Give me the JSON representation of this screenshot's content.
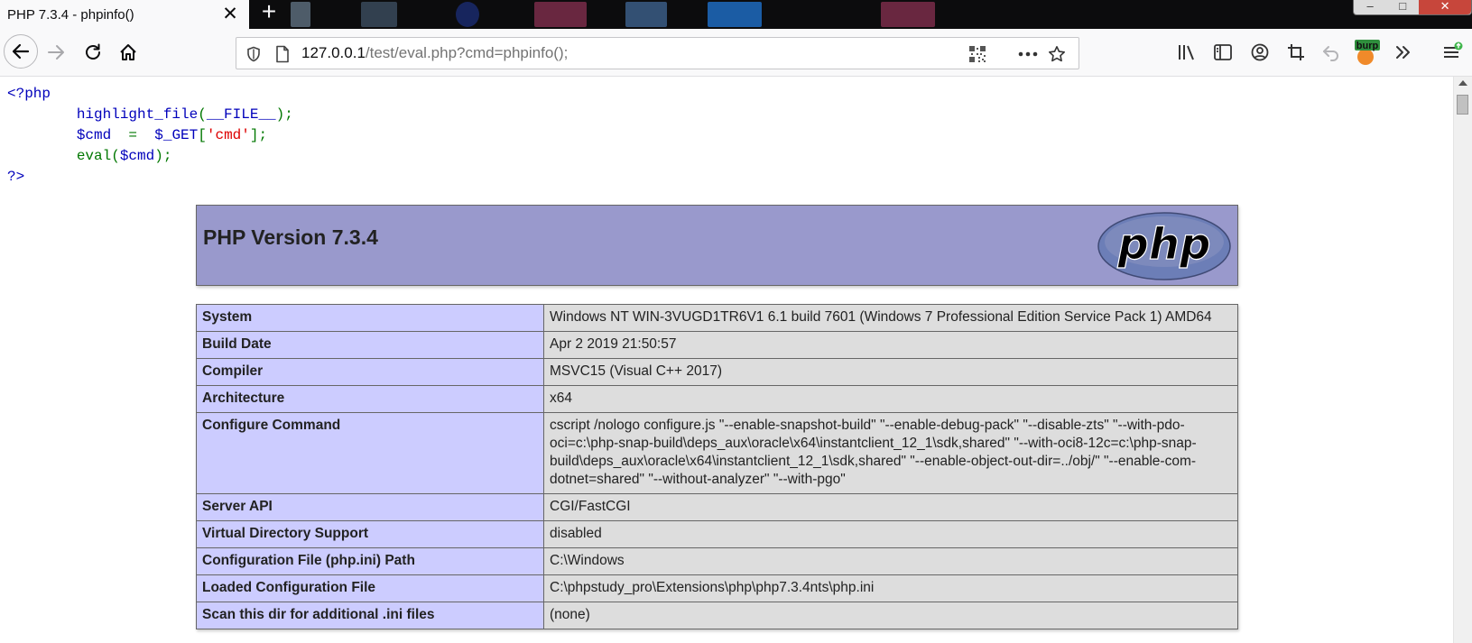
{
  "window": {
    "tab_title": "PHP 7.3.4 - phpinfo()",
    "tab_close_glyph": "✕",
    "new_tab_glyph": "+"
  },
  "navbar": {
    "url_host": "127.0.0.1",
    "url_path": "/test/eval.php?cmd=phpinfo();",
    "icons": [
      "back-arrow-icon",
      "forward-arrow-icon",
      "reload-icon",
      "home-icon",
      "shield-icon",
      "page-icon",
      "qr-code-icon",
      "more-icon",
      "star-icon",
      "library-icon",
      "sidebar-icon",
      "account-icon",
      "crop-icon",
      "undo-icon",
      "burp-extension-icon",
      "overflow-icon",
      "menu-icon"
    ],
    "burp_label": "burp"
  },
  "source_code": {
    "line1": "<?php",
    "line2_fn": "highlight_file",
    "line2_arg": "__FILE__",
    "line3_var": "$cmd",
    "line3_op": "=",
    "line3_get": "$_GET",
    "line3_key": "'cmd'",
    "line4_fn": "eval",
    "line4_arg": "$cmd",
    "line5": "?>"
  },
  "phpinfo": {
    "title": "PHP Version 7.3.4",
    "logo_text": "php",
    "rows": [
      {
        "label": "System",
        "value": "Windows NT WIN-3VUGD1TR6V1 6.1 build 7601 (Windows 7 Professional Edition Service Pack 1) AMD64"
      },
      {
        "label": "Build Date",
        "value": "Apr 2 2019 21:50:57"
      },
      {
        "label": "Compiler",
        "value": "MSVC15 (Visual C++ 2017)"
      },
      {
        "label": "Architecture",
        "value": "x64"
      },
      {
        "label": "Configure Command",
        "value": "cscript /nologo configure.js \"--enable-snapshot-build\" \"--enable-debug-pack\" \"--disable-zts\" \"--with-pdo-oci=c:\\php-snap-build\\deps_aux\\oracle\\x64\\instantclient_12_1\\sdk,shared\" \"--with-oci8-12c=c:\\php-snap-build\\deps_aux\\oracle\\x64\\instantclient_12_1\\sdk,shared\" \"--enable-object-out-dir=../obj/\" \"--enable-com-dotnet=shared\" \"--without-analyzer\" \"--with-pgo\""
      },
      {
        "label": "Server API",
        "value": "CGI/FastCGI"
      },
      {
        "label": "Virtual Directory Support",
        "value": "disabled"
      },
      {
        "label": "Configuration File (php.ini) Path",
        "value": "C:\\Windows"
      },
      {
        "label": "Loaded Configuration File",
        "value": "C:\\phpstudy_pro\\Extensions\\php\\php7.3.4nts\\php.ini"
      },
      {
        "label": "Scan this dir for additional .ini files",
        "value": "(none)"
      }
    ]
  },
  "colors": {
    "header_bg": "#9999cc",
    "label_bg": "#ccccff",
    "value_bg": "#dddddd",
    "code_default": "#0000bb",
    "code_keyword": "#007700",
    "code_string": "#dd0000"
  }
}
